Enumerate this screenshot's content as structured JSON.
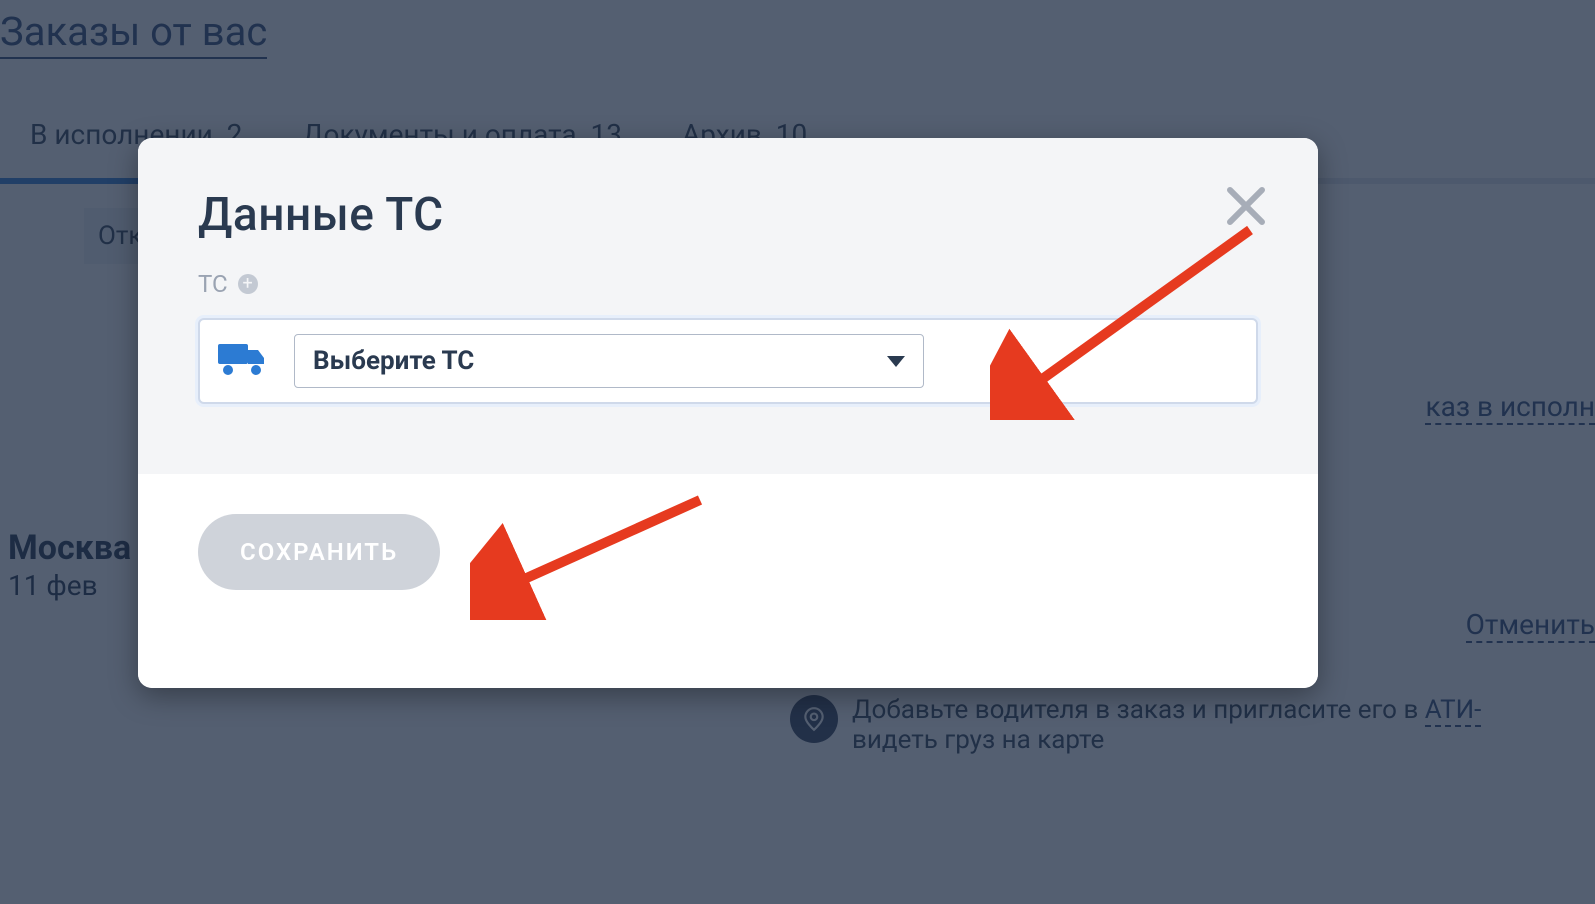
{
  "page": {
    "title": "Заказы от вас"
  },
  "tabs": {
    "inProgress": {
      "label": "В исполнении",
      "count": "2"
    },
    "docs": {
      "label": "Документы и оплата",
      "count": "13"
    },
    "archive": {
      "label": "Архив",
      "count": "10"
    }
  },
  "filters": {
    "chip1": "Отк"
  },
  "order": {
    "city": "Москва",
    "date": "11 фев",
    "actionExecute": "каз в исполн",
    "actionCancel": "Отменить"
  },
  "tip": {
    "text1": "Добавьте водителя в заказ и пригласите его в ",
    "link": "АТИ-",
    "text2": "видеть груз на карте"
  },
  "modal": {
    "title": "Данные ТС",
    "tcLabel": "ТС",
    "selectPlaceholder": "Выберите ТС",
    "saveLabel": "СОХРАНИТЬ"
  }
}
